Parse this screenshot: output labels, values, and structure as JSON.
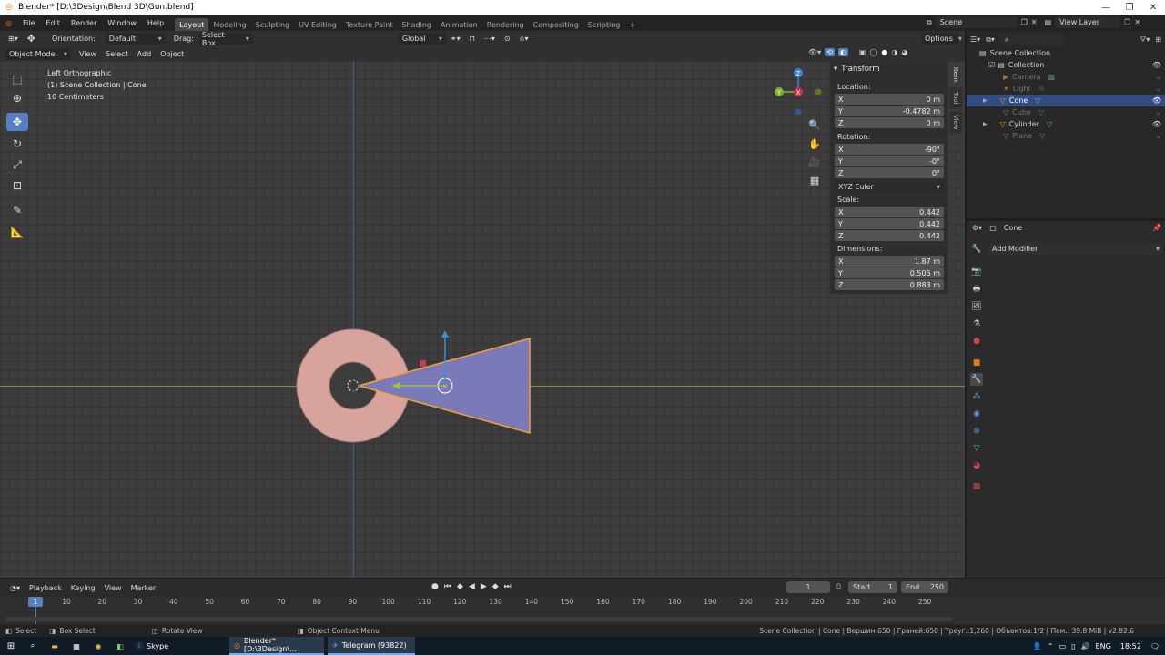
{
  "window": {
    "title": "Blender* [D:\\3Design\\Blend 3D\\Gun.blend]"
  },
  "menu": {
    "items": [
      "File",
      "Edit",
      "Render",
      "Window",
      "Help"
    ]
  },
  "workspaces": [
    "Layout",
    "Modeling",
    "Sculpting",
    "UV Editing",
    "Texture Paint",
    "Shading",
    "Animation",
    "Rendering",
    "Compositing",
    "Scripting"
  ],
  "workspace_add": "+",
  "scene": {
    "name": "Scene",
    "view_layer": "View Layer"
  },
  "tool_header": {
    "orientation_label": "Orientation:",
    "orientation_value": "Default",
    "drag_label": "Drag:",
    "drag_value": "Select Box",
    "transform_orientation": "Global",
    "options": "Options"
  },
  "viewport_header": {
    "mode": "Object Mode",
    "menus": [
      "View",
      "Select",
      "Add",
      "Object"
    ]
  },
  "viewport": {
    "info_lines": [
      "Left Orthographic",
      "(1) Scene Collection | Cone",
      "10 Centimeters"
    ],
    "gizmo": {
      "z": "Z",
      "y": "Y",
      "x": "X"
    }
  },
  "npanel": {
    "tabs": [
      "Item",
      "Tool",
      "View"
    ],
    "header": "Transform",
    "location_label": "Location:",
    "location": [
      {
        "axis": "X",
        "value": "0 m"
      },
      {
        "axis": "Y",
        "value": "-0.4782 m"
      },
      {
        "axis": "Z",
        "value": "0 m"
      }
    ],
    "rotation_label": "Rotation:",
    "rotation": [
      {
        "axis": "X",
        "value": "-90°"
      },
      {
        "axis": "Y",
        "value": "-0°"
      },
      {
        "axis": "Z",
        "value": "0°"
      }
    ],
    "rotation_mode": "XYZ Euler",
    "scale_label": "Scale:",
    "scale": [
      {
        "axis": "X",
        "value": "0.442"
      },
      {
        "axis": "Y",
        "value": "0.442"
      },
      {
        "axis": "Z",
        "value": "0.442"
      }
    ],
    "dimensions_label": "Dimensions:",
    "dimensions": [
      {
        "axis": "X",
        "value": "1.87 m"
      },
      {
        "axis": "Y",
        "value": "0.505 m"
      },
      {
        "axis": "Z",
        "value": "0.883 m"
      }
    ]
  },
  "outliner": {
    "rows": [
      {
        "name": "Scene Collection",
        "indent": 0
      },
      {
        "name": "Collection",
        "indent": 1
      },
      {
        "name": "Camera",
        "indent": 2
      },
      {
        "name": "Light",
        "indent": 2
      },
      {
        "name": "Cone",
        "indent": 2
      },
      {
        "name": "Cube",
        "indent": 2
      },
      {
        "name": "Cylinder",
        "indent": 2
      },
      {
        "name": "Plane",
        "indent": 2
      }
    ]
  },
  "properties": {
    "object_name": "Cone",
    "add_modifier": "Add Modifier"
  },
  "timeline": {
    "menus": [
      "Playback",
      "Keying",
      "View",
      "Marker"
    ],
    "current_frame": "1",
    "start_label": "Start",
    "start": "1",
    "end_label": "End",
    "end": "250",
    "ticks": [
      "10",
      "20",
      "30",
      "40",
      "50",
      "60",
      "70",
      "80",
      "90",
      "100",
      "110",
      "120",
      "130",
      "140",
      "150",
      "160",
      "170",
      "180",
      "190",
      "200",
      "210",
      "220",
      "230",
      "240",
      "250"
    ],
    "playhead": "1"
  },
  "statusbar": {
    "select": "Select",
    "box_select": "Box Select",
    "rotate_view": "Rotate View",
    "context_menu": "Object Context Menu",
    "stats": "Scene Collection | Cone | Вершин:650 | Граней:650 | Треуг.:1,260 | Объектов:1/2 | Пам.: 39.8 MiB | v2.82.6"
  },
  "taskbar": {
    "apps": [
      "Skype",
      "Blender* [D:\\3Design\\...",
      "Telegram (93822)"
    ],
    "lang": "ENG",
    "time": "18:52"
  },
  "colors": {
    "accent": "#5680c2",
    "selection": "#334d80",
    "outline": "#f5a030",
    "cone": "#7a7ab8",
    "torus": "#d8a39c"
  }
}
